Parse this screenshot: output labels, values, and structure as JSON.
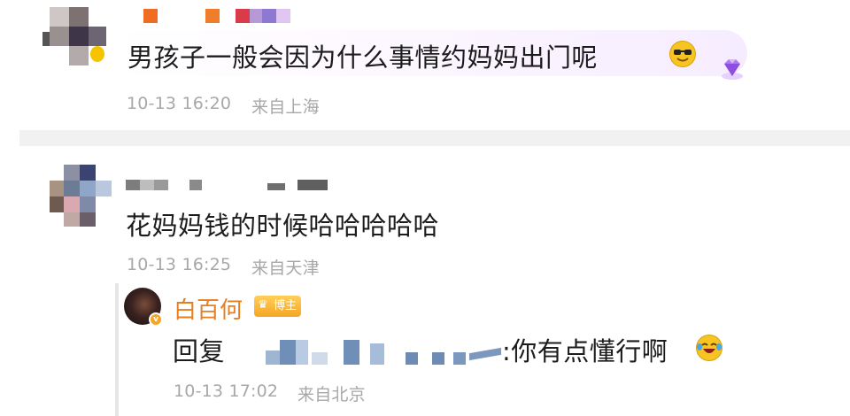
{
  "comments": [
    {
      "text": "男孩子一般会因为什么事情约妈妈出门呢",
      "time": "10-13 16:20",
      "location": "来自上海"
    },
    {
      "text": "花妈妈钱的时候哈哈哈哈哈",
      "time": "10-13 16:25",
      "location": "来自天津"
    }
  ],
  "reply": {
    "username": "白百何",
    "badge": "博主",
    "prefix": "回复",
    "text": ":你有点懂行啊",
    "time": "10-13 17:02",
    "location": "来自北京"
  },
  "colors": {
    "username": "#e67e22",
    "meta_text": "#a8a8a8",
    "badge_gold": "#f5a623",
    "bubble_purple": "#f6ecff"
  },
  "icons": [
    "avatar-blurred",
    "smiling-face-with-sunglasses-emoji",
    "diamond-gem-icon",
    "verified-v-icon",
    "crown-icon",
    "laughing-crying-emoji"
  ]
}
